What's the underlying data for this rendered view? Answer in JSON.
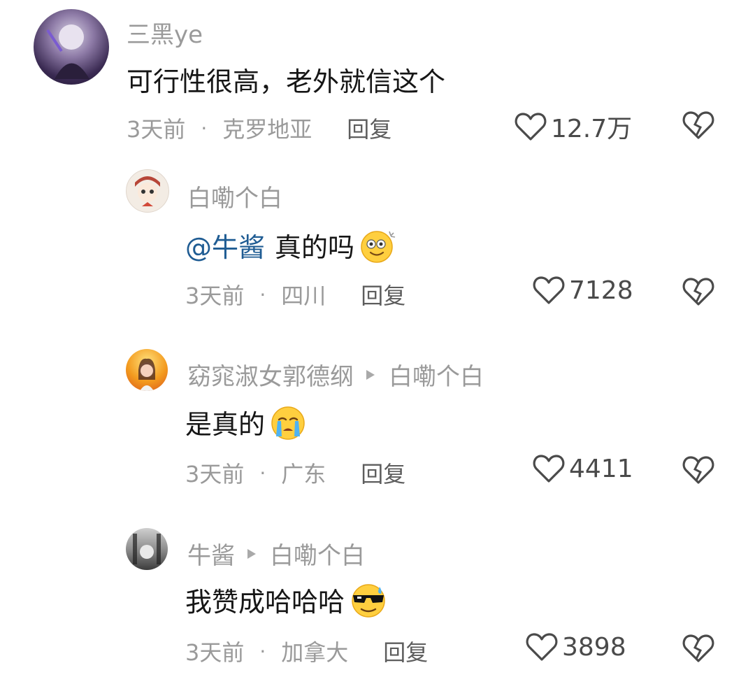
{
  "comments": [
    {
      "username": "三黑ye",
      "reply_to": "",
      "mention": "",
      "text": "可行性很高，老外就信这个",
      "time": "3天前",
      "location": "克罗地亚",
      "reply_label": "回复",
      "likes": "12.7万",
      "emoji": ""
    },
    {
      "username": "白嘞个白",
      "reply_to": "",
      "mention": "@牛酱",
      "text": "真的吗",
      "time": "3天前",
      "location": "四川",
      "reply_label": "回复",
      "likes": "7128",
      "emoji": "dizzy-smile-emoji"
    },
    {
      "username": "窈窕淑女郭德纲",
      "reply_to": "白嘞个白",
      "mention": "",
      "text": "是真的",
      "time": "3天前",
      "location": "广东",
      "reply_label": "回复",
      "likes": "4411",
      "emoji": "crying-emoji"
    },
    {
      "username": "牛酱",
      "reply_to": "白嘞个白",
      "mention": "",
      "text": "我赞成哈哈哈",
      "time": "3天前",
      "location": "加拿大",
      "reply_label": "回复",
      "likes": "3898",
      "emoji": "cool-sweat-emoji"
    }
  ],
  "dot": "·",
  "icons": {
    "like": "heart-outline-icon",
    "dislike": "broken-heart-icon",
    "reply_arrow": "triangle-right-icon"
  },
  "colors": {
    "mention": "#1f5c93",
    "meta": "#9a9a9a",
    "text": "#161616"
  }
}
